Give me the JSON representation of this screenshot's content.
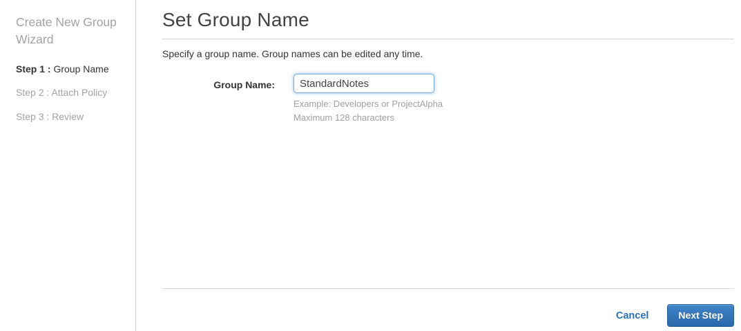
{
  "sidebar": {
    "title": "Create New Group Wizard",
    "steps": [
      {
        "prefix": "Step 1 :",
        "label": " Group Name",
        "active": true
      },
      {
        "prefix": "Step 2 :",
        "label": " Attach Policy",
        "active": false
      },
      {
        "prefix": "Step 3 :",
        "label": " Review",
        "active": false
      }
    ]
  },
  "main": {
    "title": "Set Group Name",
    "description": "Specify a group name. Group names can be edited any time.",
    "form": {
      "label": "Group Name:",
      "value": "StandardNotes",
      "hint_example": "Example: Developers or ProjectAlpha",
      "hint_max": "Maximum 128 characters"
    },
    "footer": {
      "cancel_label": "Cancel",
      "next_label": "Next Step"
    }
  },
  "colors": {
    "accent_blue": "#2a72b8",
    "button_gradient_top": "#3f85c9",
    "button_gradient_bottom": "#2a68a9",
    "muted_gray": "#a3a3a3",
    "divider_gray": "#cccccc"
  }
}
